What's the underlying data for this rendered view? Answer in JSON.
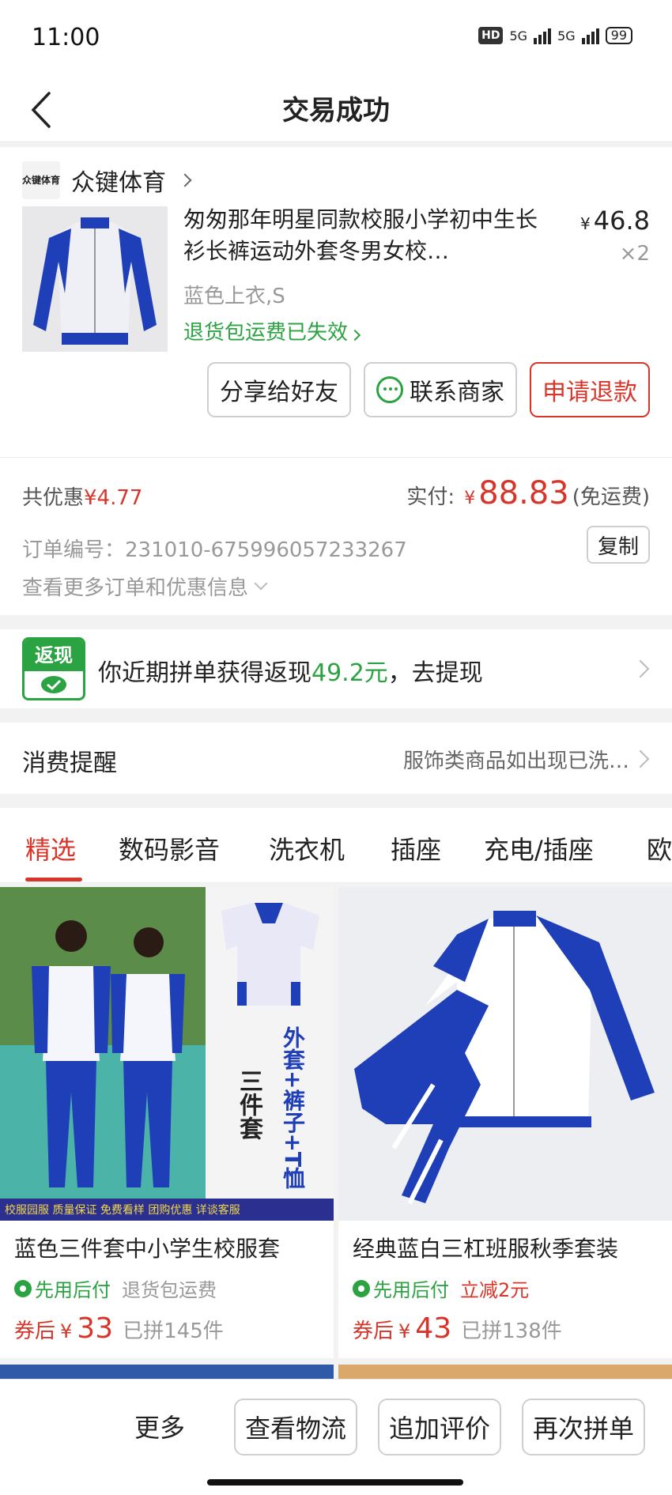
{
  "status_bar": {
    "time": "11:00",
    "hd_label": "HD",
    "network_1": "5G",
    "network_2": "5G",
    "battery": "99"
  },
  "nav": {
    "title": "交易成功"
  },
  "order": {
    "store_logo_text": "众键体育",
    "store_name": "众键体育",
    "product_title": "匆匆那年明星同款校服小学初中生长衫长裤运动外套冬男女校…",
    "price_currency": "¥",
    "price": "46.8",
    "quantity": "×2",
    "spec": "蓝色上衣,S",
    "return_shipping": "退货包运费已失效",
    "buttons": {
      "share": "分享给好友",
      "contact": "联系商家",
      "refund": "申请退款"
    }
  },
  "payment": {
    "discount_label": "共优惠",
    "discount_value": "¥4.77",
    "paid_label": "实付:",
    "currency": "¥",
    "paid_amount": "88.83",
    "shipping_note": "(免运费)",
    "order_number": "订单编号：231010-675996057233267",
    "copy_label": "复制",
    "more_info": "查看更多订单和优惠信息"
  },
  "cashback": {
    "icon_label": "返现",
    "text_prefix": "你近期拼单获得返现",
    "amount": "49.2元",
    "text_suffix": "，去提现"
  },
  "reminder": {
    "label": "消费提醒",
    "value": "服饰类商品如出现已洗…"
  },
  "tabs": [
    "精选",
    "数码影音",
    "洗衣机",
    "插座",
    "充电/插座",
    "欧"
  ],
  "recommendations": [
    {
      "title": "蓝色三件套中小学生校服套",
      "tag1": "先用后付",
      "tag2": "退货包运费",
      "coupon_label": "券后",
      "currency": "¥",
      "price": "33",
      "sold": "已拼145件",
      "img_text_1": "三件套",
      "img_text_2": "外套+裤子+T恤",
      "img_banner": "校服园服 质量保证 免费看样 团购优惠 详谈客服"
    },
    {
      "title": "经典蓝白三杠班服秋季套装",
      "tag1": "先用后付",
      "tag2": "立减2元",
      "coupon_label": "券后",
      "currency": "¥",
      "price": "43",
      "sold": "已拼138件"
    }
  ],
  "bottom_bar": {
    "more": "更多",
    "logistics": "查看物流",
    "add_review": "追加评价",
    "reorder": "再次拼单"
  },
  "colors": {
    "accent_red": "#d8352a",
    "accent_green": "#2ca343",
    "uniform_blue": "#1f3fb8"
  }
}
